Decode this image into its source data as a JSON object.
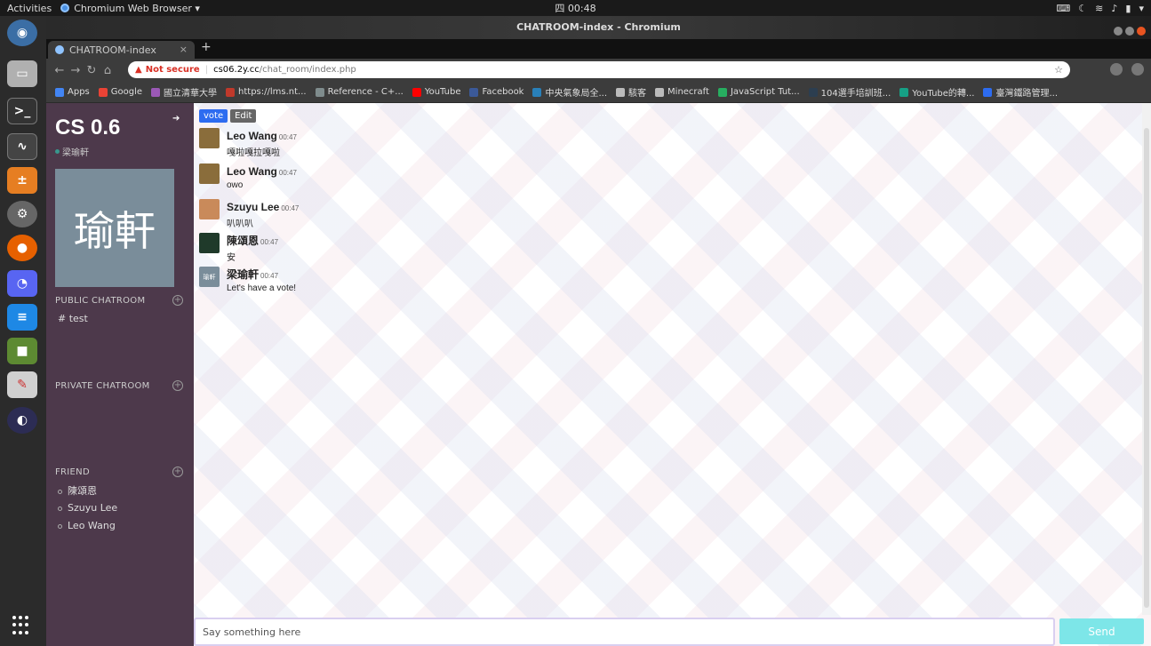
{
  "topbar": {
    "activities": "Activities",
    "app_menu": "Chromium Web Browser ▾",
    "clock": "四 00:48",
    "tray_icons": [
      "keyboard-icon",
      "night-light-icon",
      "wifi-icon",
      "volume-icon",
      "battery-icon",
      "power-menu-icon"
    ]
  },
  "window": {
    "title": "CHATROOM-index - Chromium",
    "tab_title": "CHATROOM-index",
    "tab_close": "×",
    "new_tab": "+"
  },
  "address": {
    "warning": "Not secure",
    "separator": "|",
    "host": "cs06.2y.cc",
    "path": "/chat_room/index.php"
  },
  "bookmarks": [
    {
      "label": "Apps",
      "color": "#4285f4"
    },
    {
      "label": "Google",
      "color": "#ea4335"
    },
    {
      "label": "國立清華大學",
      "color": "#9b59b6"
    },
    {
      "label": "https://lms.nt...",
      "color": "#c0392b"
    },
    {
      "label": "Reference - C+...",
      "color": "#7f8c8d"
    },
    {
      "label": "YouTube",
      "color": "#ff0000"
    },
    {
      "label": "Facebook",
      "color": "#3b5998"
    },
    {
      "label": "中央氣象局全...",
      "color": "#2980b9"
    },
    {
      "label": "駭客",
      "color": "#bbbbbb"
    },
    {
      "label": "Minecraft",
      "color": "#bbbbbb"
    },
    {
      "label": "JavaScript Tut...",
      "color": "#27ae60"
    },
    {
      "label": "104選手培訓班...",
      "color": "#2c3e50"
    },
    {
      "label": "YouTube的轉...",
      "color": "#16a085"
    },
    {
      "label": "臺灣鐵路管理...",
      "color": "#2d6cf0"
    }
  ],
  "sidebar": {
    "brand": "CS 0.6",
    "user": "梁瑜軒",
    "avatar_text": "瑜軒",
    "public_title": "PUBLIC CHATROOM",
    "public_rooms": [
      "# test"
    ],
    "private_title": "PRIVATE CHATROOM",
    "friend_title": "FRIEND",
    "friends": [
      "陳頌恩",
      "Szuyu Lee",
      "Leo Wang"
    ]
  },
  "chat": {
    "vote_label": "vote",
    "edit_label": "Edit",
    "messages": [
      {
        "name": "Leo Wang",
        "time": "00:47",
        "text": "嘎啦嘎拉嘎啦",
        "avatar_color": "#8a6d3b"
      },
      {
        "name": "Leo Wang",
        "time": "00:47",
        "text": "owo",
        "avatar_color": "#8a6d3b"
      },
      {
        "name": "Szuyu Lee",
        "time": "00:47",
        "text": "叭叭叭",
        "avatar_color": "#c98a5a"
      },
      {
        "name": "陳頌恩",
        "time": "00:47",
        "text": "安",
        "avatar_color": "#1f3a2a"
      },
      {
        "name": "梁瑜軒",
        "time": "00:47",
        "text": "Let's have a vote!",
        "avatar_color": "#7a8d9a",
        "avatar_text": "瑜軒"
      }
    ],
    "input_placeholder": "Say something here",
    "send_label": "Send"
  }
}
